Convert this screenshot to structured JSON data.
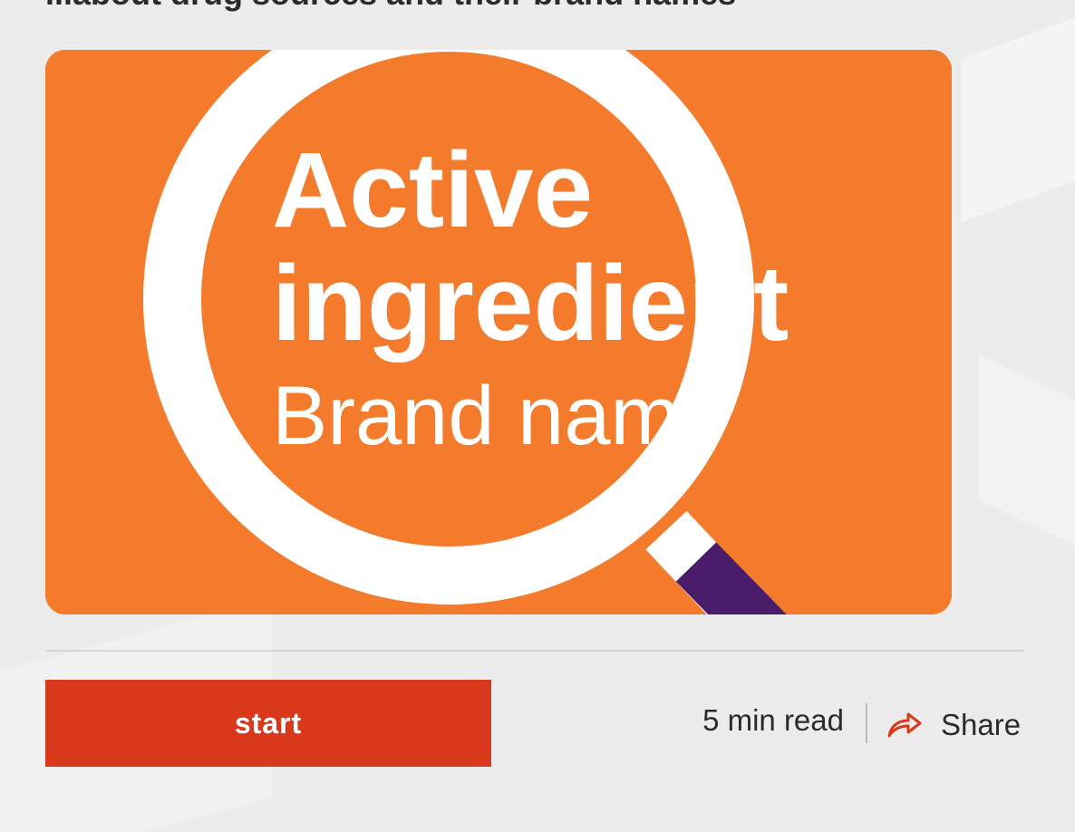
{
  "article": {
    "heading_partial": "...about drug sources and their brand names"
  },
  "hero": {
    "headline_line1": "Active",
    "headline_line2": "ingredient",
    "subline": "Brand name",
    "icon": "magnifying-glass-icon"
  },
  "actions": {
    "start_label": "start",
    "read_time": "5 min read",
    "share_label": "Share",
    "share_icon": "share-arrow-icon"
  },
  "colors": {
    "hero_bg": "#f37b2b",
    "start_button": "#d9391a",
    "share_icon": "#d9391a",
    "handle_purple": "#4a1d6b",
    "text": "#2b2b2b"
  }
}
